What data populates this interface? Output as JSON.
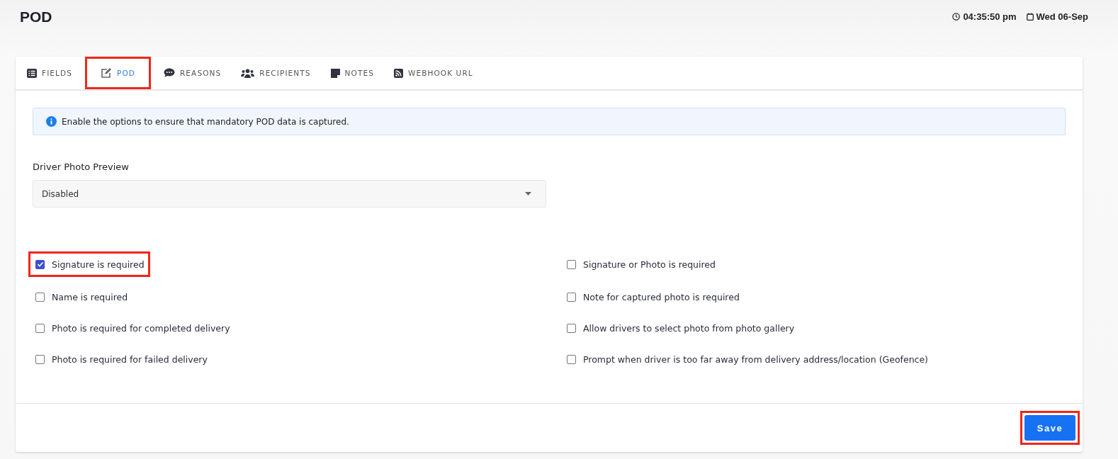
{
  "header": {
    "title": "POD",
    "time": "04:35:50 pm",
    "date": "Wed 06-Sep"
  },
  "tabs": [
    {
      "label": "FIELDS",
      "selected": false,
      "highlighted": false
    },
    {
      "label": "POD",
      "selected": true,
      "highlighted": true
    },
    {
      "label": "REASONS",
      "selected": false,
      "highlighted": false
    },
    {
      "label": "RECIPIENTS",
      "selected": false,
      "highlighted": false
    },
    {
      "label": "NOTES",
      "selected": false,
      "highlighted": false
    },
    {
      "label": "WEBHOOK URL",
      "selected": false,
      "highlighted": false
    }
  ],
  "info": "Enable the options to ensure that mandatory POD data is captured.",
  "driver_photo_preview": {
    "label": "Driver Photo Preview",
    "value": "Disabled"
  },
  "options_left": [
    {
      "label": "Signature is required",
      "checked": true,
      "highlighted": true
    },
    {
      "label": "Name is required",
      "checked": false,
      "highlighted": false
    },
    {
      "label": "Photo is required for completed delivery",
      "checked": false,
      "highlighted": false
    },
    {
      "label": "Photo is required for failed delivery",
      "checked": false,
      "highlighted": false
    }
  ],
  "options_right": [
    {
      "label": "Signature or Photo is required",
      "checked": false,
      "highlighted": false
    },
    {
      "label": "Note for captured photo is required",
      "checked": false,
      "highlighted": false
    },
    {
      "label": "Allow drivers to select photo from photo gallery",
      "checked": false,
      "highlighted": false
    },
    {
      "label": "Prompt when driver is too far away from delivery address/location (Geofence)",
      "checked": false,
      "highlighted": false
    }
  ],
  "save_button": {
    "label": "Save",
    "highlighted": true
  }
}
